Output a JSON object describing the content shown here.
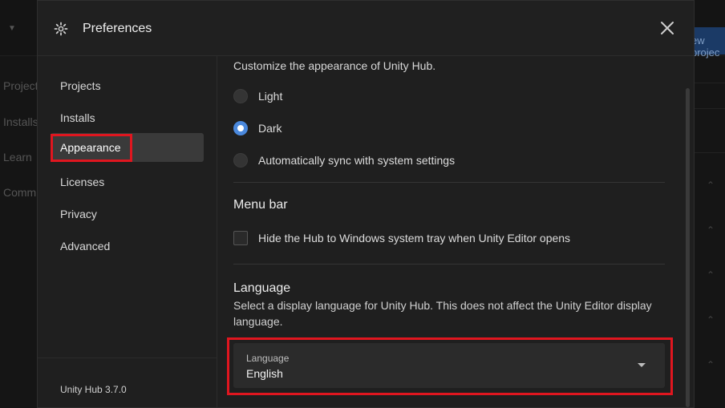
{
  "background": {
    "button_label": "ew projec",
    "nav": [
      "Projects",
      "Installs",
      "Learn",
      "Community"
    ]
  },
  "dialog": {
    "title": "Preferences",
    "icons": {
      "settings": "gear-icon",
      "close": "close-icon"
    }
  },
  "sidebar": {
    "items": [
      {
        "label": "Projects"
      },
      {
        "label": "Installs"
      },
      {
        "label": "Appearance",
        "active": true
      },
      {
        "label": "Licenses"
      },
      {
        "label": "Privacy"
      },
      {
        "label": "Advanced"
      }
    ],
    "version": "Unity Hub 3.7.0"
  },
  "appearance": {
    "intro": "Customize the appearance of Unity Hub.",
    "themes": [
      {
        "label": "Light",
        "selected": false
      },
      {
        "label": "Dark",
        "selected": true
      },
      {
        "label": "Automatically sync with system settings",
        "selected": false
      }
    ]
  },
  "menu_bar": {
    "title": "Menu bar",
    "checkbox_label": "Hide the Hub to Windows system tray when Unity Editor opens",
    "checked": false
  },
  "language": {
    "title": "Language",
    "description": "Select a display language for Unity Hub. This does not affect the Unity Editor display language.",
    "field_label": "Language",
    "value": "English"
  },
  "colors": {
    "accent": "#4a88dc",
    "highlight": "#e0161f",
    "dialog_bg": "#1f1f1f"
  }
}
